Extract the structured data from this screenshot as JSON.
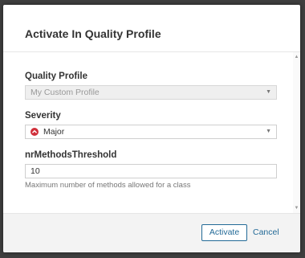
{
  "dialog": {
    "title": "Activate In Quality Profile"
  },
  "fields": {
    "quality_profile": {
      "label": "Quality Profile",
      "value": "My Custom Profile",
      "disabled": true
    },
    "severity": {
      "label": "Severity",
      "value": "Major",
      "icon": "major-severity-icon",
      "icon_color": "#d02f3a"
    },
    "threshold": {
      "label": "nrMethodsThreshold",
      "value": "10",
      "help": "Maximum number of methods allowed for a class"
    }
  },
  "footer": {
    "activate_label": "Activate",
    "cancel_label": "Cancel"
  },
  "colors": {
    "primary": "#236a97",
    "overlay": "#3f3f3f"
  }
}
